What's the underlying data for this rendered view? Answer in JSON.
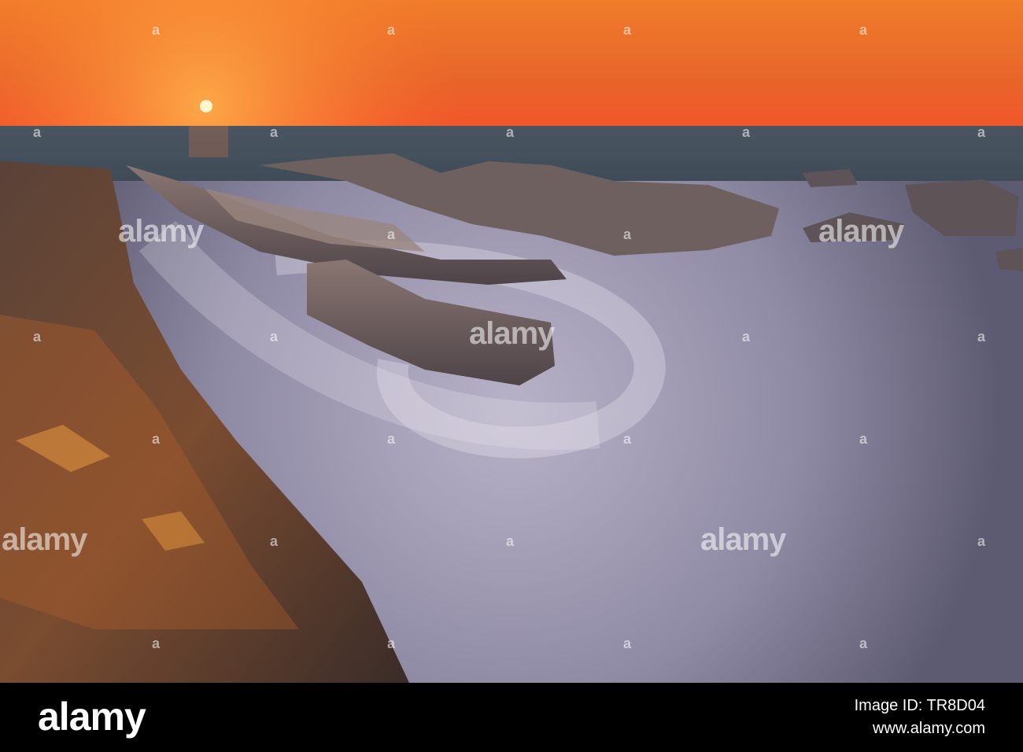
{
  "watermark": {
    "brand": "alamy",
    "glyph": "a"
  },
  "footer": {
    "logo": "alamy",
    "image_id": "Image ID: TR8D04",
    "url": "www.alamy.com"
  },
  "colors": {
    "sky_top": "#f07428",
    "sky_horizon": "#ff6a1a",
    "sea": "#3a4a55",
    "mist": "#d8d0de",
    "rock": "#6a5a58",
    "footer_bg": "#000000"
  }
}
